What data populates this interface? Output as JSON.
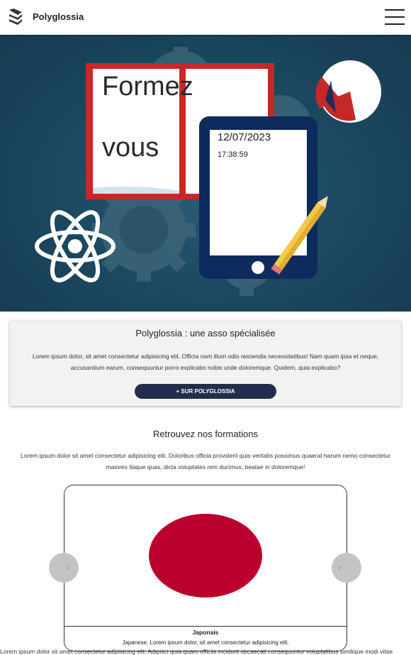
{
  "navbar": {
    "brand": "Polyglossia",
    "brand_icon": "books-icon",
    "menu_icon": "hamburger-icon"
  },
  "hero": {
    "line1": "Formez",
    "line2": "vous",
    "date": "12/07/2023",
    "time": "17:38:59",
    "colors": {
      "background": "#1c4a62",
      "book": "#c62828",
      "tablet": "#0d2b5c",
      "pie": "#c62828"
    }
  },
  "about": {
    "title": "Polyglossia : une asso spécialisée",
    "text": "Lorem ipsum dolor, sit amet consectetur adipisicing elit. Officia nam illum odio reiciendis necessitatibus! Nam quam ipsa et neque, accusantium earum, consequuntur porro explicabo nobis unde doloremque. Quidem, quia explicabo?",
    "button": "+ SUR POLYGLOSSIA"
  },
  "formations": {
    "title": "Retrouvez nos formations",
    "text": "Lorem ipsum dolor sit amet consectetur adipisicing elit. Doloribus officia provident quis veritatis possimus quaerat harum nemo consectetur maiores itaque quas, dicta voluptates rem ducimus, beatae in doloremque!"
  },
  "carousel": {
    "prev": "‹",
    "next": "›",
    "slide_title": "Japonais",
    "slide_text": "Japanese, Lorem ipsum dolor, sit amet consectetur adipisicing elit.",
    "flag_color": "#bc002d"
  },
  "footer": {
    "text": "Lorem ipsum dolor sit amet consectetur adipisicing elit. Adipisci quia quam officiis incidunt obcaecati consequuntur voluptatibus similique modi vitae"
  }
}
